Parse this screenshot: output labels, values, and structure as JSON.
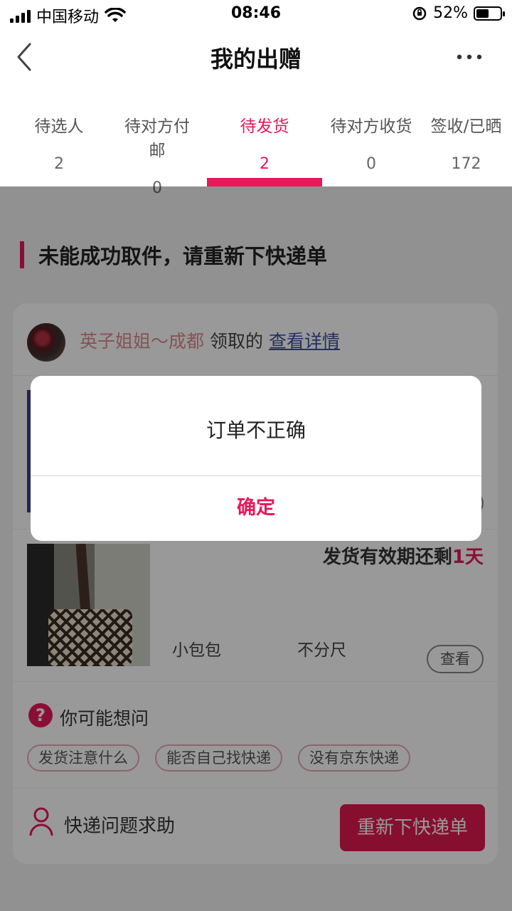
{
  "status_bar": {
    "carrier": "中国移动",
    "time": "08:46",
    "battery_text": "52%",
    "battery_level": 0.52,
    "icons": [
      "signal-icon",
      "wifi-icon",
      "rotation-lock-icon",
      "battery-icon"
    ]
  },
  "nav": {
    "title": "我的出赠",
    "back_icon": "chevron-left-icon",
    "more_icon": "more-dots-icon"
  },
  "tabs": [
    {
      "label": "待选人",
      "count": "2",
      "active": false
    },
    {
      "label": "待对方付邮",
      "count": "0",
      "active": false
    },
    {
      "label": "待发货",
      "count": "2",
      "active": true
    },
    {
      "label": "待对方收货",
      "count": "0",
      "active": false
    },
    {
      "label": "签收/已晒",
      "count": "172",
      "active": false
    }
  ],
  "section": {
    "heading": "未能成功取件，请重新下快递单"
  },
  "receiver": {
    "name": "英子姐姐～成都",
    "action": "领取的",
    "link": "查看详情"
  },
  "items": [
    {
      "name": "小包包",
      "size": "不分尺",
      "deadline_prefix": "发货有效期还剩",
      "deadline_num": "1",
      "deadline_unit": "天",
      "view_label": "查看"
    }
  ],
  "faq": {
    "title": "你可能想问",
    "chips": [
      "发货注意什么",
      "能否自己找快递",
      "没有京东快递"
    ]
  },
  "help": {
    "label": "快递问题求助",
    "button": "重新下快递单"
  },
  "dialog": {
    "message": "订单不正确",
    "confirm": "确定"
  },
  "colors": {
    "accent": "#e8185a",
    "button": "#e0184e",
    "link": "#3f4f9e",
    "overlay": "rgba(0,0,0,0.4)"
  }
}
